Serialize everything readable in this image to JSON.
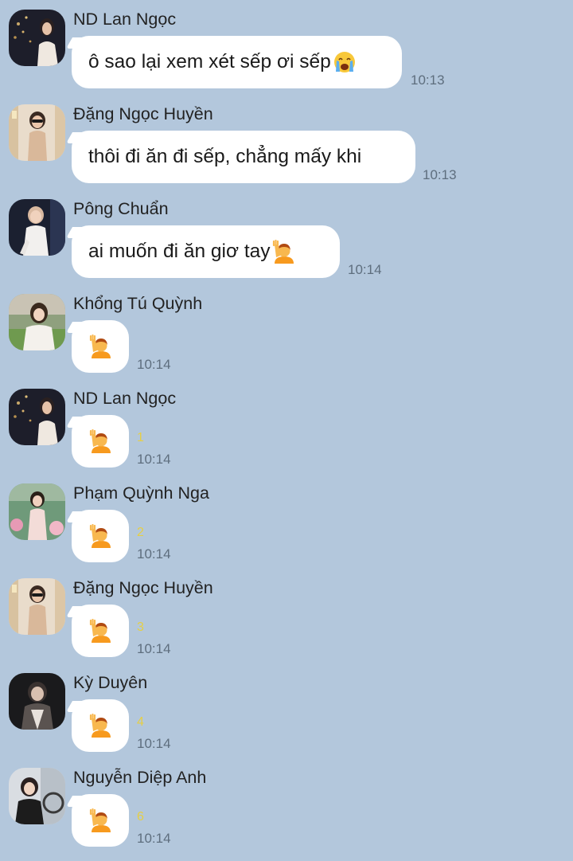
{
  "chat": {
    "messages": [
      {
        "sender": "ND Lan Ngọc",
        "text": "ô sao lại xem xét sếp ơi sếp",
        "emoji": "crying-face-icon",
        "time": "10:13",
        "count": ""
      },
      {
        "sender": "Đặng Ngọc Huyền",
        "text": "thôi đi ăn đi sếp, chẳng mấy khi",
        "emoji": "",
        "time": "10:13",
        "count": ""
      },
      {
        "sender": "Pông Chuẩn",
        "text": "ai muốn đi ăn giơ tay",
        "emoji": "raising-hand-icon",
        "time": "10:14",
        "count": ""
      },
      {
        "sender": "Khổng Tú Quỳnh",
        "text": "",
        "emoji": "raising-hand-icon",
        "time": "10:14",
        "count": ""
      },
      {
        "sender": "ND Lan Ngọc",
        "text": "",
        "emoji": "raising-hand-icon",
        "time": "10:14",
        "count": "1"
      },
      {
        "sender": "Phạm Quỳnh Nga",
        "text": "",
        "emoji": "raising-hand-icon",
        "time": "10:14",
        "count": "2"
      },
      {
        "sender": "Đặng Ngọc Huyền",
        "text": "",
        "emoji": "raising-hand-icon",
        "time": "10:14",
        "count": "3"
      },
      {
        "sender": "Kỳ Duyên",
        "text": "",
        "emoji": "raising-hand-icon",
        "time": "10:14",
        "count": "4"
      },
      {
        "sender": "Nguyễn Diệp Anh",
        "text": "",
        "emoji": "raising-hand-icon",
        "time": "10:14",
        "count": "6"
      }
    ]
  },
  "colors": {
    "background": "#b3c7dc",
    "bubble": "#ffffff",
    "timestamp": "#5e6e7e",
    "reaction_count": "#e6cf45"
  }
}
